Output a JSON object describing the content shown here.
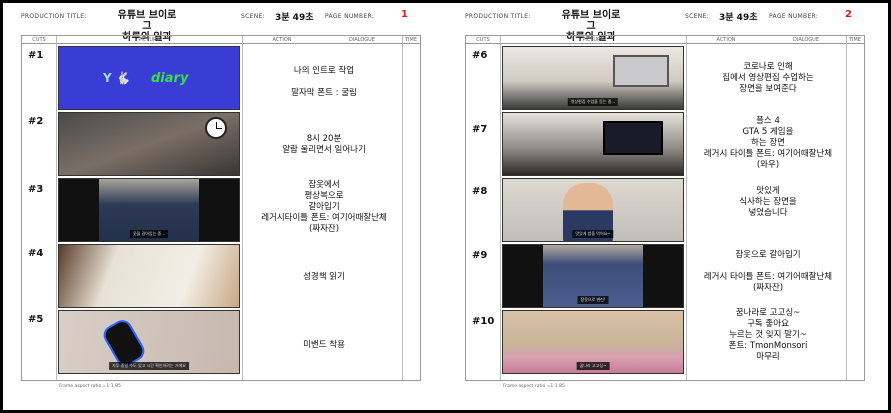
{
  "labels": {
    "production_title": "PRODUCTION TITLE:",
    "scene": "SCENE:",
    "page_number": "PAGE NUMBER:",
    "cuts": "CUTS",
    "picture": "PICTURE",
    "action": "ACTION",
    "dialogue": "DIALOGUE",
    "time": "TIME",
    "aspect": "Frame aspect ratio =1:1.85"
  },
  "production_title": "유튜브 브이로그\n하루의 일과",
  "scene": "3분 49초",
  "colors": {
    "page_number": "#d62020",
    "diary_bg": "#3a3cd6",
    "diary_text": "#35e04a"
  },
  "pages": [
    {
      "page_number": "1",
      "cuts": [
        {
          "num": "#1",
          "action": "나의 인트로 작업\n\n말자막 폰트 : 굴림",
          "picture_text": "diary",
          "logo": "Y 🐇"
        },
        {
          "num": "#2",
          "action": "8시 20분\n알람 울리면서 일어나기"
        },
        {
          "num": "#3",
          "action": "잠옷에서\n평상복으로\n갈아입기\n레거시타이틀 폰트: 여기어때잘난체\n(짜자잔)",
          "caption": "옷을 갈아입는 중..."
        },
        {
          "num": "#4",
          "action": "성경책 읽기"
        },
        {
          "num": "#5",
          "action": "미밴드 착용",
          "caption": "자투 중일 수도 있고 시간 확인하려는 거에요"
        }
      ]
    },
    {
      "page_number": "2",
      "cuts": [
        {
          "num": "#6",
          "action": "코로나로 인해\n집에서 영상편집 수업하는\n장면을 보여준다",
          "caption": "영상편집 수업을 듣는 중..."
        },
        {
          "num": "#7",
          "action": "플스 4\nGTA 5 게임을\n하는 장면\n레거시 타이틀 폰트: 여기어때잘난체\n(와우)"
        },
        {
          "num": "#8",
          "action": "맛있게\n식사하는 장면을\n넣었습니다",
          "caption": "맛있게 밥을 먹어요~"
        },
        {
          "num": "#9",
          "action": "잠옷으로 갈아입기\n\n레거시 타이틀 폰트: 여기어때잘난체\n(짜자잔)",
          "caption": "잠옷으로 변신!"
        },
        {
          "num": "#10",
          "action": "꿈나라로 고고싱~\n구독 좋아요\n누르는 것 잊지 말기~\n폰트: TmonMonsori\n마무리",
          "caption": "꿈나라 고고싱~"
        }
      ]
    }
  ]
}
